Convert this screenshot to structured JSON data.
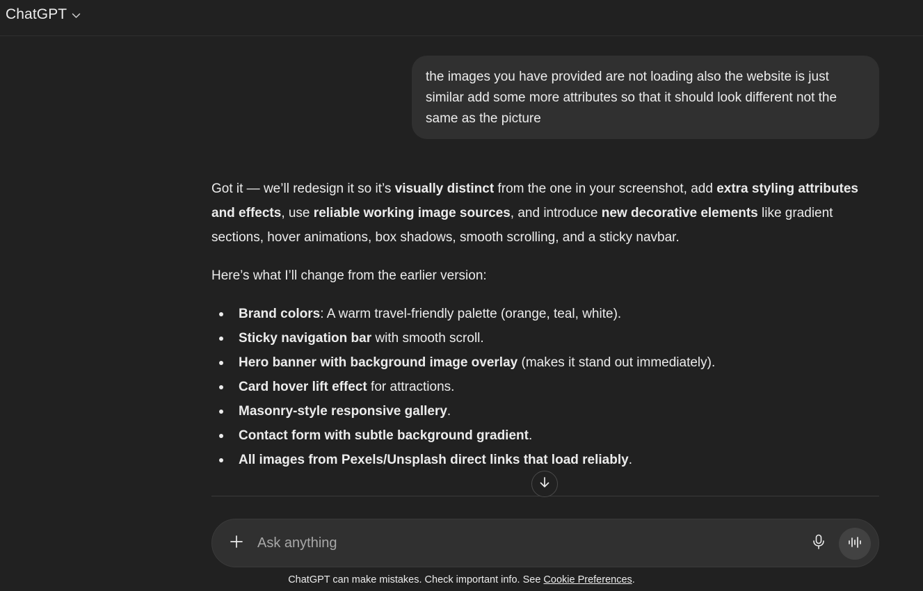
{
  "header": {
    "title": "ChatGPT",
    "title_icon": "chevron-down-icon"
  },
  "user_message": {
    "text": "the images you have provided are not loading also the website is just similar add some more attributes so that it should look different not the same as the picture"
  },
  "assistant_message": {
    "intro": {
      "t1": "Got it — we’ll redesign it so it’s ",
      "b1": "visually distinct",
      "t2": " from the one in your screenshot, add ",
      "b2": "extra styling attributes and effects",
      "t3": ", use ",
      "b3": "reliable working image sources",
      "t4": ", and introduce ",
      "b4": "new decorative elements",
      "t5": " like gradient sections, hover animations, box shadows, smooth scrolling, and a sticky navbar."
    },
    "lead": "Here’s what I’ll change from the earlier version:",
    "bullets": [
      {
        "bold": "Brand colors",
        "rest": ": A warm travel-friendly palette (orange, teal, white)."
      },
      {
        "bold": "Sticky navigation bar",
        "rest": " with smooth scroll."
      },
      {
        "bold": "Hero banner with background image overlay",
        "rest": " (makes it stand out immediately)."
      },
      {
        "bold": "Card hover lift effect",
        "rest": " for attractions."
      },
      {
        "bold": "Masonry-style responsive gallery",
        "rest": "."
      },
      {
        "bold": "Contact form with subtle background gradient",
        "rest": "."
      },
      {
        "bold": "All images from Pexels/Unsplash direct links that load reliably",
        "rest": "."
      }
    ]
  },
  "composer": {
    "placeholder": "Ask anything",
    "value": "",
    "plus_icon": "plus-icon",
    "mic_icon": "microphone-icon",
    "voice_icon": "voice-mode-icon"
  },
  "scroll_button": {
    "icon": "arrow-down-icon"
  },
  "footer": {
    "text": "ChatGPT can make mistakes. Check important info. See ",
    "link": "Cookie Preferences",
    "end": "."
  },
  "colors": {
    "background": "#212121",
    "bubble": "#303030",
    "text": "#ececec",
    "placeholder": "#a8a8a8",
    "voice_button": "#424242"
  }
}
